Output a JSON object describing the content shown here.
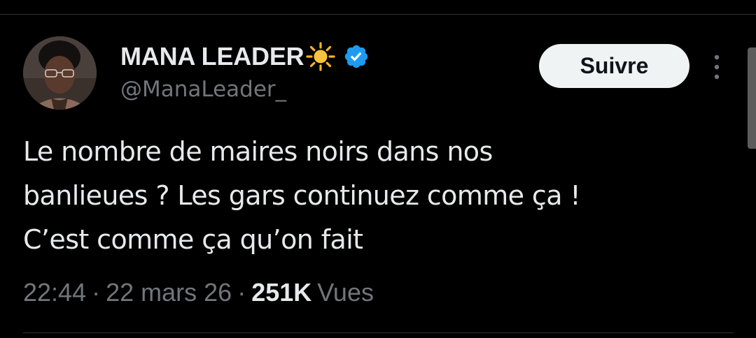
{
  "author": {
    "display_name": "MANA LEADER",
    "name_emoji_icon": "sun-icon",
    "verified_icon": "verified-badge-icon",
    "handle": "@ManaLeader_"
  },
  "actions": {
    "follow_label": "Suivre",
    "more_icon": "more-vertical-icon"
  },
  "tweet": {
    "lines": [
      "Le nombre de maires noirs dans nos",
      "banlieues ? Les gars continuez comme ça !",
      "C’est comme ça qu’on fait"
    ]
  },
  "meta": {
    "time": "22:44",
    "separator": "·",
    "date": "22 mars 26",
    "views_count": "251K",
    "views_label": "Vues"
  },
  "colors": {
    "background": "#000000",
    "text_primary": "#e7e9ea",
    "text_secondary": "#71767b",
    "verified": "#1d9bf0",
    "follow_bg": "#eff3f4"
  }
}
